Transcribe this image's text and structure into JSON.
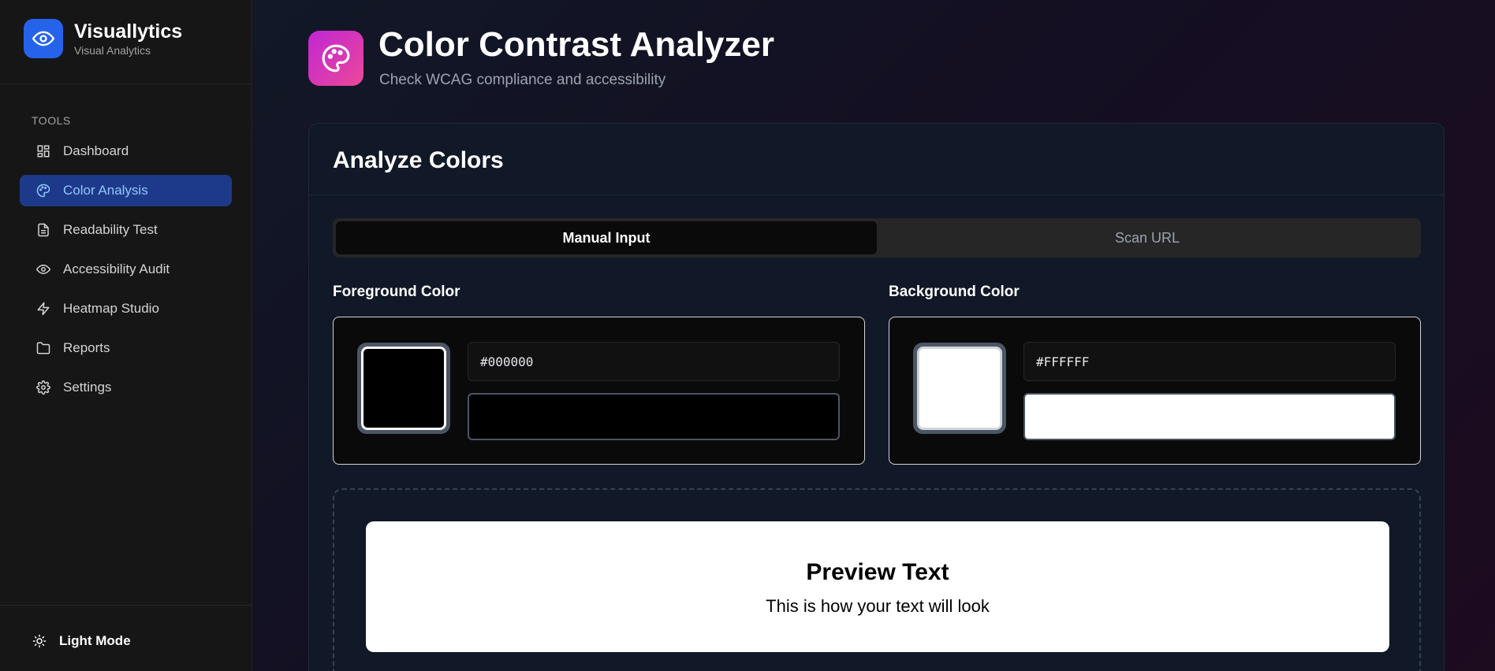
{
  "brand": {
    "name": "Visuallytics",
    "subtitle": "Visual Analytics"
  },
  "sidebar": {
    "section_label": "TOOLS",
    "items": [
      {
        "label": "Dashboard",
        "icon": "dashboard-icon"
      },
      {
        "label": "Color Analysis",
        "icon": "palette-icon",
        "active": true
      },
      {
        "label": "Readability Test",
        "icon": "document-icon"
      },
      {
        "label": "Accessibility Audit",
        "icon": "eye-icon"
      },
      {
        "label": "Heatmap Studio",
        "icon": "lightning-icon"
      },
      {
        "label": "Reports",
        "icon": "folder-icon"
      },
      {
        "label": "Settings",
        "icon": "gear-icon"
      }
    ],
    "theme_toggle": "Light Mode"
  },
  "header": {
    "title": "Color Contrast Analyzer",
    "subtitle": "Check WCAG compliance and accessibility"
  },
  "card": {
    "title": "Analyze Colors",
    "tabs": [
      {
        "label": "Manual Input",
        "active": true
      },
      {
        "label": "Scan URL",
        "active": false
      }
    ],
    "foreground": {
      "label": "Foreground Color",
      "hex": "#000000"
    },
    "background": {
      "label": "Background Color",
      "hex": "#FFFFFF"
    },
    "preview": {
      "title": "Preview Text",
      "body": "This is how your text will look"
    }
  },
  "colors": {
    "accent": "#2563eb",
    "active_nav_bg": "#1d3a8a",
    "header_icon_gradient": [
      "#c026d3",
      "#ec4899"
    ]
  }
}
